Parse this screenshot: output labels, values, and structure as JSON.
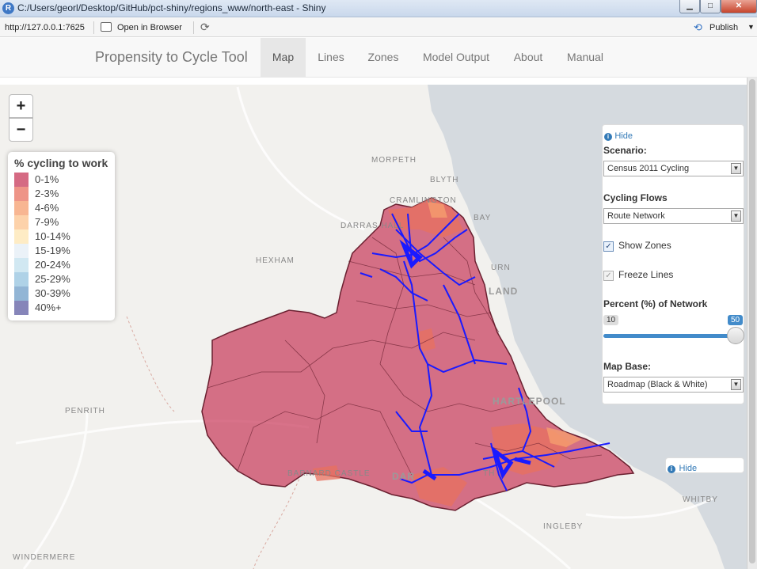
{
  "window": {
    "title": "C:/Users/georl/Desktop/GitHub/pct-shiny/regions_www/north-east - Shiny",
    "app_icon": "R",
    "minimize": "▁",
    "maximize": "□",
    "close": "✕"
  },
  "toolbar": {
    "url": "http://127.0.0.1:7625",
    "open_in_browser": "Open in Browser",
    "refresh_icon": "⟳",
    "publish_icon": "⟲",
    "publish": "Publish",
    "publish_caret": "▼"
  },
  "navbar": {
    "brand": "Propensity to Cycle Tool",
    "tabs": [
      {
        "label": "Map",
        "active": true
      },
      {
        "label": "Lines",
        "active": false
      },
      {
        "label": "Zones",
        "active": false
      },
      {
        "label": "Model Output",
        "active": false
      },
      {
        "label": "About",
        "active": false
      },
      {
        "label": "Manual",
        "active": false
      }
    ]
  },
  "map": {
    "zoom_in": "+",
    "zoom_out": "−",
    "legend": {
      "title": "% cycling to work",
      "items": [
        {
          "label": "0-1%",
          "color": "#c73859"
        },
        {
          "label": "2-3%",
          "color": "#e8705f"
        },
        {
          "label": "4-6%",
          "color": "#f59d6e"
        },
        {
          "label": "7-9%",
          "color": "#fcc38e"
        },
        {
          "label": "10-14%",
          "color": "#fde6b1"
        },
        {
          "label": "15-19%",
          "color": "#e4eef6"
        },
        {
          "label": "20-24%",
          "color": "#c2e0ed"
        },
        {
          "label": "25-29%",
          "color": "#94c3df"
        },
        {
          "label": "30-39%",
          "color": "#6d9cc7"
        },
        {
          "label": "40%+",
          "color": "#5e5ca2"
        }
      ]
    },
    "place_labels": {
      "morpeth": "MORPETH",
      "blyth": "BLYTH",
      "cramlington": "CRAMLINGTON",
      "bay": "BAY",
      "darras_hall": "DARRAS HALL",
      "hexham": "HEXHAM",
      "urn": "URN",
      "land": "LAND",
      "penrith": "PENRITH",
      "hartlepool": "HARTLEPOOL",
      "barnard_castle": "BARNARD CASTLE",
      "darlington": "DAR",
      "whitby": "WHITBY",
      "ingleby": "INGLEBY",
      "windermere": "WINDERMERE",
      "sunderland_tail": "TH"
    },
    "colors": {
      "zones_main": "#c73859",
      "zones_light": "#e8705f",
      "zones_lighter": "#f59d6e",
      "routes": "#1010ff",
      "sea": "#d5dadf",
      "land": "#f2f1ee"
    }
  },
  "controls": {
    "hide_label": "Hide",
    "info_icon": "i",
    "scenario_label": "Scenario:",
    "scenario_value": "Census 2011 Cycling",
    "flows_label": "Cycling Flows",
    "flows_value": "Route Network",
    "show_zones_label": "Show Zones",
    "show_zones_checked": true,
    "freeze_lines_label": "Freeze Lines",
    "freeze_lines_checked": true,
    "percent_label": "Percent (%) of Network",
    "slider_min": "10",
    "slider_max": "50",
    "slider_value_fraction": 1.0,
    "map_base_label": "Map Base:",
    "map_base_value": "Roadmap (Black & White)",
    "dropdown_arrow": "▼",
    "check_mark": "✓"
  },
  "panel2": {
    "hide_label": "Hide"
  }
}
